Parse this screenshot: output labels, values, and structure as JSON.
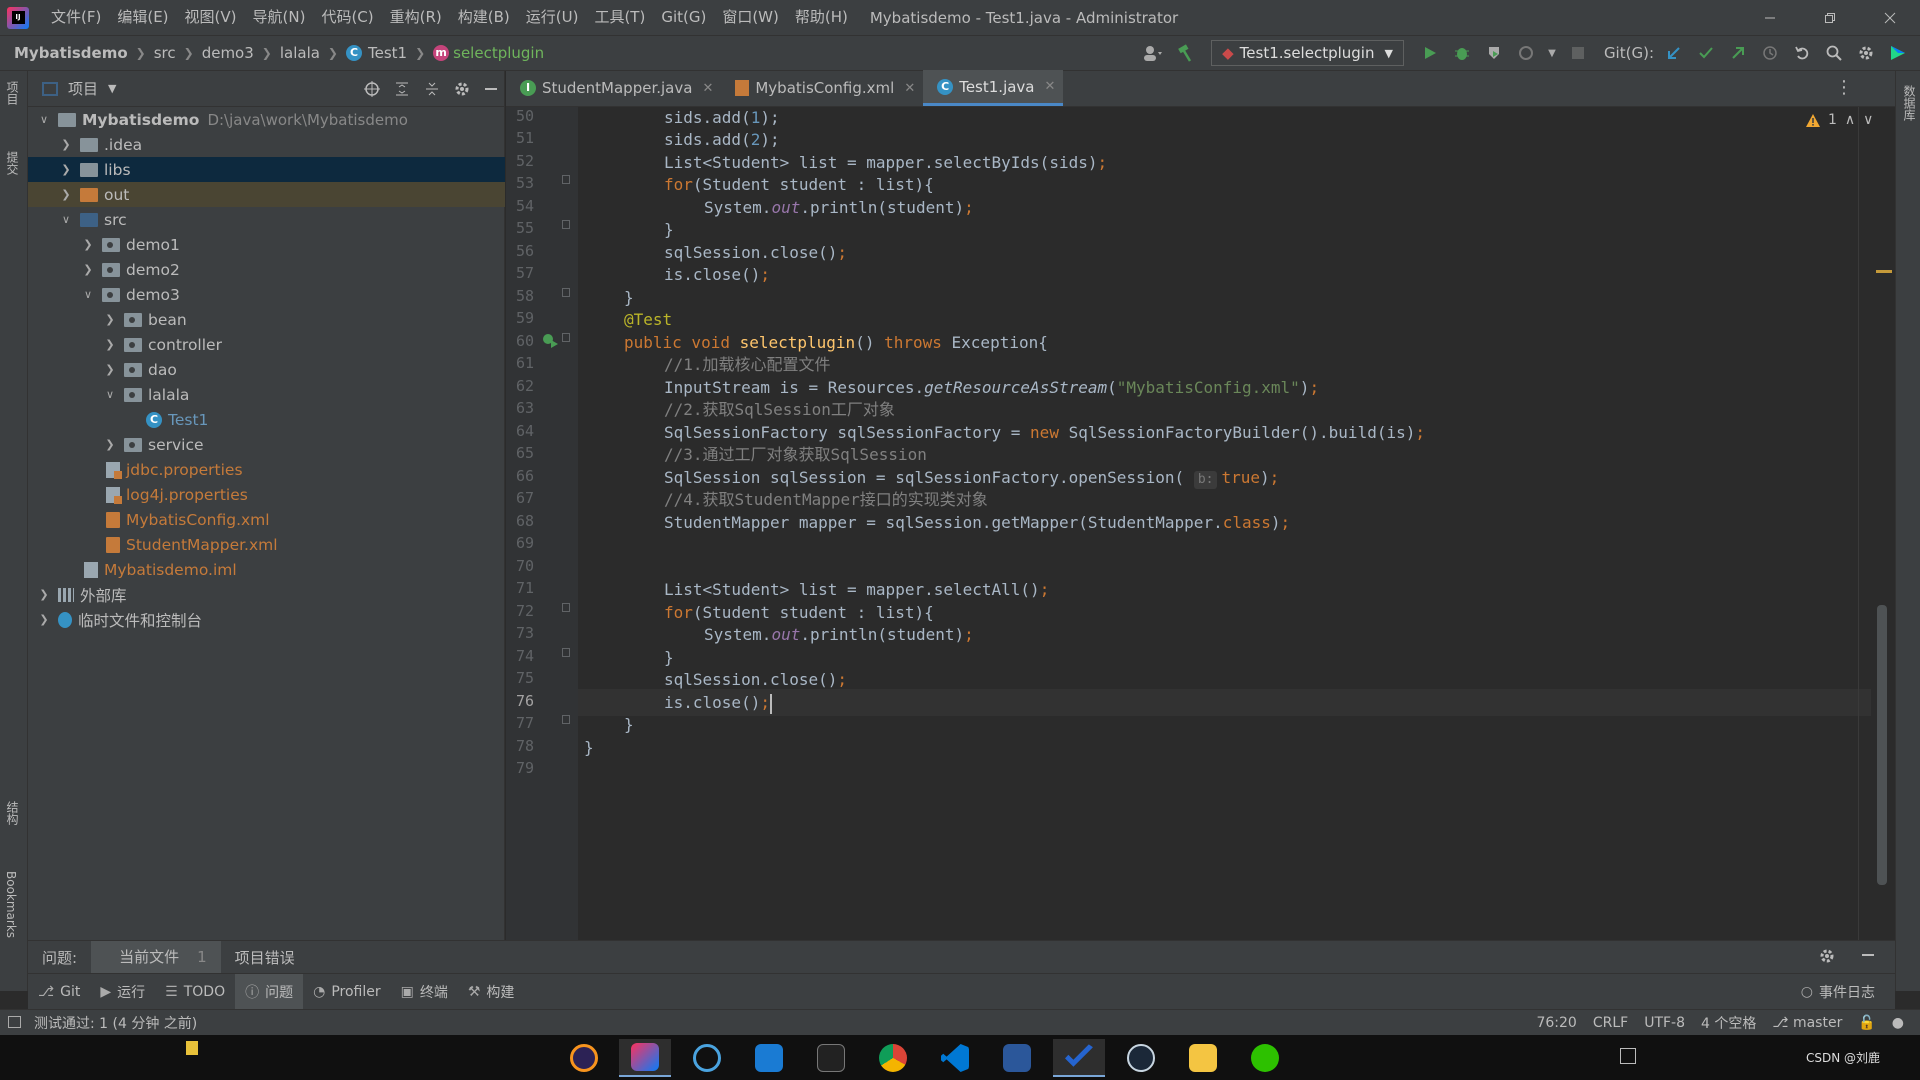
{
  "titlebar": {
    "menu": [
      "文件(F)",
      "编辑(E)",
      "视图(V)",
      "导航(N)",
      "代码(C)",
      "重构(R)",
      "构建(B)",
      "运行(U)",
      "工具(T)",
      "Git(G)",
      "窗口(W)",
      "帮助(H)"
    ],
    "title": "Mybatisdemo - Test1.java - Administrator"
  },
  "navbar": {
    "crumbs": [
      "Mybatisdemo",
      "src",
      "demo3",
      "lalala",
      "Test1",
      "selectplugin"
    ],
    "run_config": "Test1.selectplugin",
    "git_label": "Git(G):"
  },
  "left_strip": {
    "project_tab": "项目",
    "commit_tab": "提交",
    "structure_tab": "结构",
    "bookmarks_tab": "Bookmarks"
  },
  "right_strip": {
    "database_tab": "数据库"
  },
  "project_panel": {
    "title": "项目",
    "tree": [
      {
        "label": "Mybatisdemo",
        "path": "D:\\java\\work\\Mybatisdemo"
      },
      {
        "label": ".idea"
      },
      {
        "label": "libs"
      },
      {
        "label": "out"
      },
      {
        "label": "src"
      },
      {
        "label": "demo1"
      },
      {
        "label": "demo2"
      },
      {
        "label": "demo3"
      },
      {
        "label": "bean"
      },
      {
        "label": "controller"
      },
      {
        "label": "dao"
      },
      {
        "label": "lalala"
      },
      {
        "label": "Test1"
      },
      {
        "label": "service"
      },
      {
        "label": "jdbc.properties"
      },
      {
        "label": "log4j.properties"
      },
      {
        "label": "MybatisConfig.xml"
      },
      {
        "label": "StudentMapper.xml"
      },
      {
        "label": "Mybatisdemo.iml"
      },
      {
        "label": "外部库"
      },
      {
        "label": "临时文件和控制台"
      }
    ]
  },
  "editor": {
    "tabs": [
      "StudentMapper.java",
      "MybatisConfig.xml",
      "Test1.java"
    ],
    "active_tab": "Test1.java",
    "warning_count": "1",
    "line_numbers": [
      "50",
      "51",
      "52",
      "53",
      "54",
      "55",
      "56",
      "57",
      "58",
      "59",
      "60",
      "61",
      "62",
      "63",
      "64",
      "65",
      "66",
      "67",
      "68",
      "69",
      "70",
      "71",
      "72",
      "73",
      "74",
      "75",
      "76",
      "77",
      "78",
      "79"
    ],
    "current_line": "76",
    "param_hint": "b:"
  },
  "problems_bar": {
    "label": "问题:",
    "current_file": "当前文件",
    "current_file_count": "1",
    "project_errors": "项目错误"
  },
  "tool_buttons": [
    "Git",
    "运行",
    "TODO",
    "问题",
    "Profiler",
    "终端",
    "构建"
  ],
  "event_log": "事件日志",
  "status": {
    "message": "测试通过: 1 (4 分钟 之前)",
    "position": "76:20",
    "line_sep": "CRLF",
    "encoding": "UTF-8",
    "indent": "4 个空格",
    "branch": "master"
  },
  "taskbar": {
    "watermark": "CSDN @刘鹿"
  },
  "colors": {
    "keyword": "#cc7832",
    "annotation": "#bbb529",
    "comment": "#808080",
    "string": "#6a8759",
    "number": "#6897bb",
    "field": "#9876aa",
    "method_decl": "#ffc66d",
    "accent": "#4a88c7"
  }
}
